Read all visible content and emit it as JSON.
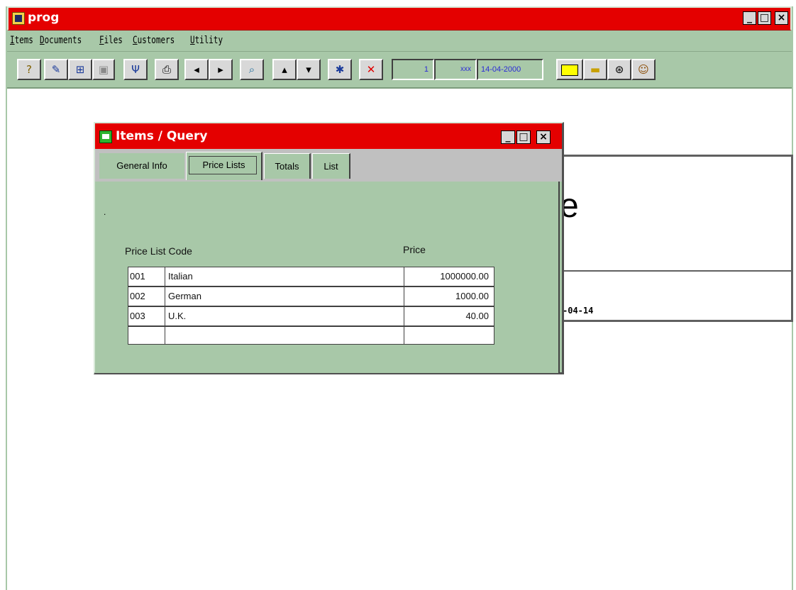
{
  "app": {
    "title": "prog"
  },
  "window_controls": {
    "minimize": "_",
    "maximize": "□",
    "close": "×"
  },
  "menubar": {
    "items": [
      "Items",
      "Documents",
      "Files",
      "Customers",
      "Utility"
    ]
  },
  "toolbar": {
    "record_number": "1",
    "user": "xxx",
    "date": "14-04-2000",
    "icons": [
      "help-icon",
      "edit-icon",
      "new-icon",
      "save-icon",
      "filter-icon",
      "print-icon",
      "prev-icon",
      "next-icon",
      "find-icon",
      "first-icon",
      "last-icon",
      "zoom-icon",
      "delete-icon",
      "note-icon",
      "folder-icon",
      "network-icon",
      "user-icon"
    ],
    "colors": {
      "field_text": "#2b2bd6",
      "note_yellow": "#ffff00"
    }
  },
  "background_form": {
    "partial_title": "e",
    "partial_date": "-04-14"
  },
  "query_window": {
    "title": "Items / Query",
    "tabs": [
      "General Info",
      "Price Lists",
      "Totals",
      "List"
    ],
    "active_tab": "Price Lists",
    "note": "."
  },
  "price_lists": {
    "headers": {
      "code": "Price List Code",
      "price": "Price"
    },
    "rows": [
      {
        "code": "001",
        "name": "Italian",
        "price": "1000000.00"
      },
      {
        "code": "002",
        "name": "German",
        "price": "1000.00"
      },
      {
        "code": "003",
        "name": "U.K.",
        "price": "40.00"
      },
      {
        "code": "",
        "name": "",
        "price": ""
      }
    ]
  },
  "colors": {
    "titlebar": "#e40000",
    "panel": "#a8c8a8",
    "tabstrip": "#c0c0c0"
  }
}
